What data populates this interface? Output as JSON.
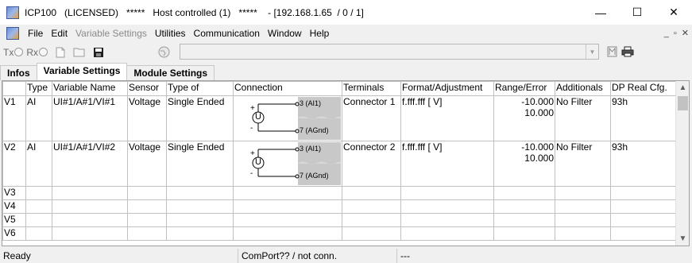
{
  "window": {
    "title": "ICP100   (LICENSED)   *****   Host controlled (1)   *****    - [192.168.1.65  / 0 / 1]",
    "minimize": "—",
    "maximize": "☐",
    "close": "✕"
  },
  "menu": {
    "items": [
      "File",
      "Edit",
      "Variable Settings",
      "Utilities",
      "Communication",
      "Window",
      "Help"
    ],
    "mdi_min": "_",
    "mdi_restore": "▫",
    "mdi_close": "✕"
  },
  "toolbar": {
    "tx_label": "Tx",
    "rx_label": "Rx",
    "combo_value": ""
  },
  "tabs": [
    "Infos",
    "Variable Settings",
    "Module Settings"
  ],
  "active_tab": "Variable Settings",
  "grid": {
    "columns": [
      "",
      "Type",
      "Variable Name",
      "Sensor",
      "Type of",
      "Connection",
      "Terminals",
      "Format/Adjustment",
      "Range/Error",
      "Additionals",
      "DP Real Cfg."
    ],
    "rows": [
      {
        "id": "V1",
        "type": "AI",
        "name": "UI#1/A#1/VI#1",
        "sensor": "Voltage",
        "type_of": "Single Ended",
        "pin_top": "3 (AI1)",
        "pin_bottom": "7 (AGnd)",
        "terminals": "Connector 1",
        "format": "f.fff.fff [ V]",
        "range_min": "-10.000",
        "range_max": "10.000",
        "additionals": "No Filter",
        "dp_cfg": "93h"
      },
      {
        "id": "V2",
        "type": "AI",
        "name": "UI#1/A#1/VI#2",
        "sensor": "Voltage",
        "type_of": "Single Ended",
        "pin_top": "3 (AI1)",
        "pin_bottom": "7 (AGnd)",
        "terminals": "Connector 2",
        "format": "f.fff.fff [ V]",
        "range_min": "-10.000",
        "range_max": "10.000",
        "additionals": "No Filter",
        "dp_cfg": "93h"
      }
    ],
    "empty_rows": [
      "V3",
      "V4",
      "V5",
      "V6"
    ],
    "source_symbol": "U",
    "plus_sign": "+",
    "minus_sign": "-"
  },
  "statusbar": {
    "ready": "Ready",
    "port": "ComPort?? / not conn.",
    "extra": "---"
  }
}
